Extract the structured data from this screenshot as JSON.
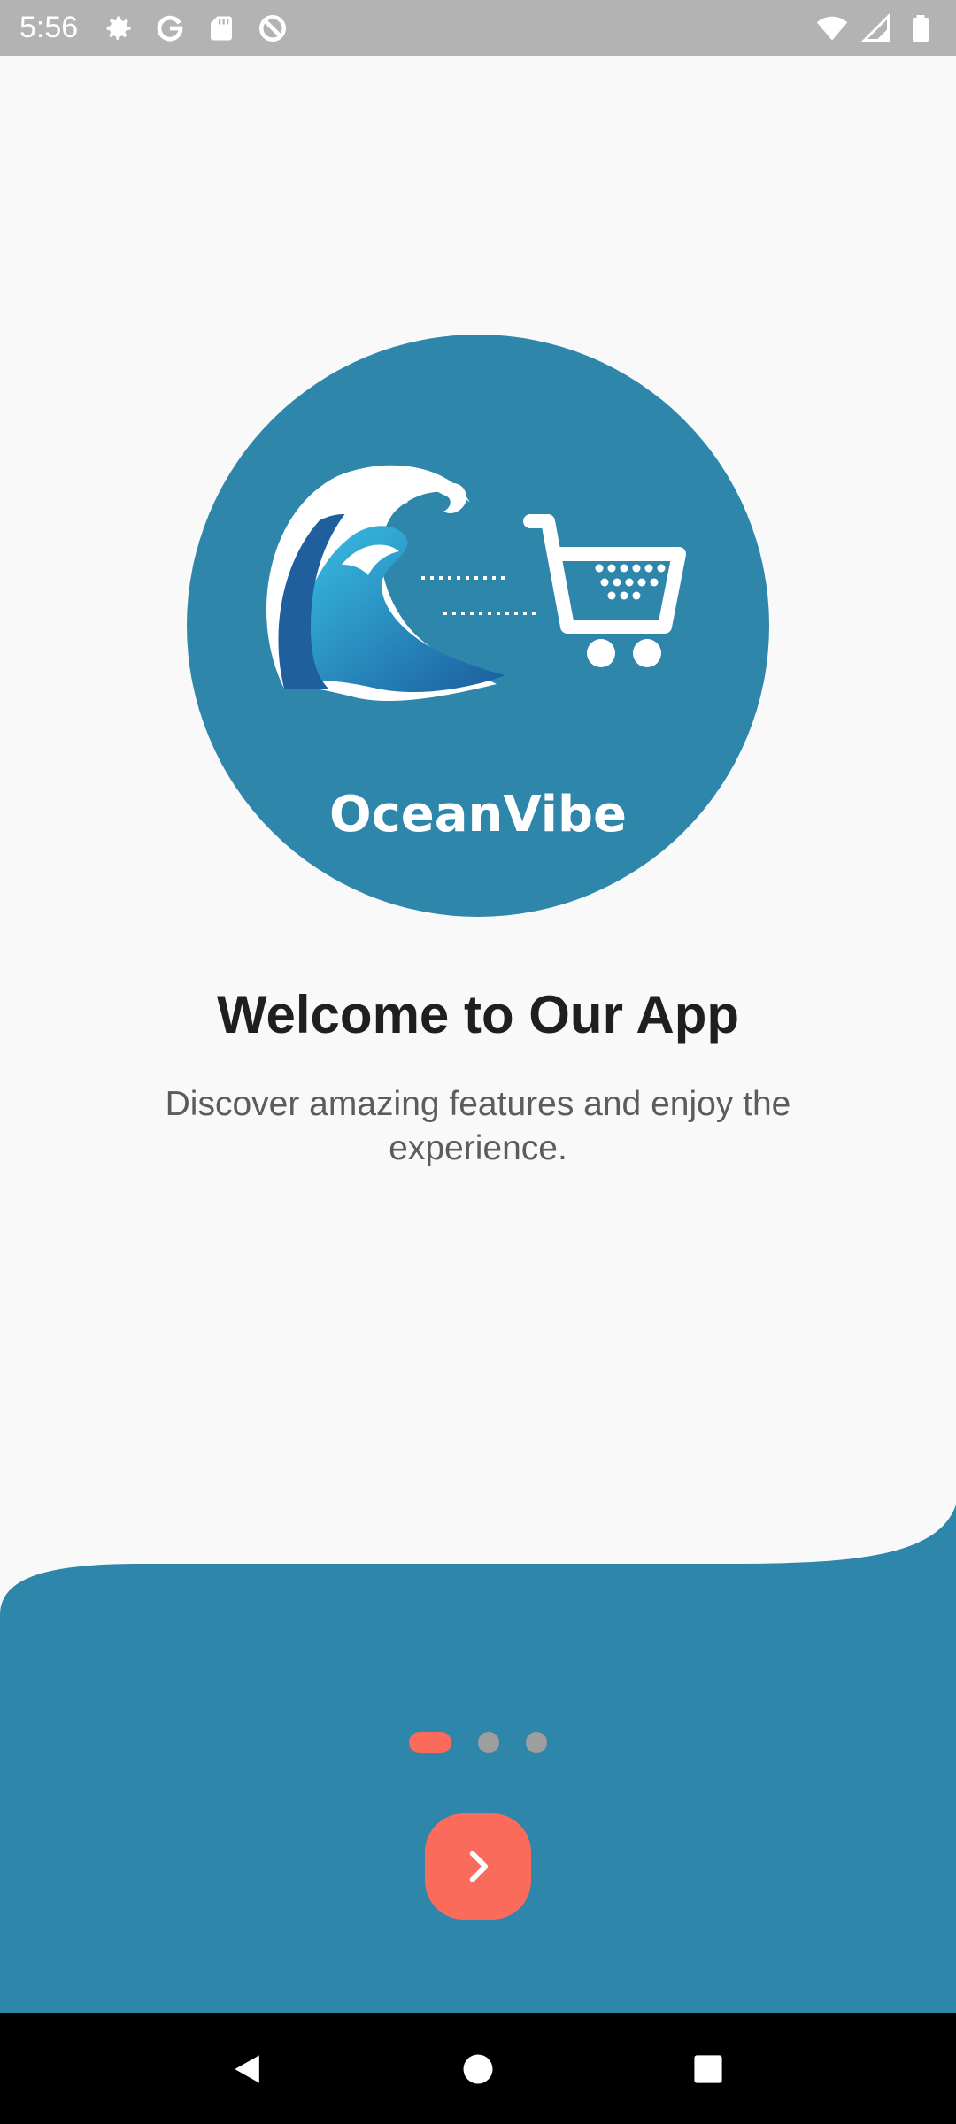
{
  "status_bar": {
    "time": "5:56",
    "left_icons": [
      "settings-icon",
      "google-icon",
      "sd-card-icon",
      "data-saver-icon"
    ],
    "right_icons": [
      "wifi-icon",
      "cell-signal-icon",
      "battery-icon"
    ]
  },
  "logo": {
    "brand_name": "OceanVibe",
    "circle_color": "#2e86ab"
  },
  "onboarding": {
    "title": "Welcome to Our App",
    "subtitle": "Discover amazing features and enjoy the experience.",
    "page_count": 3,
    "current_page": 1
  },
  "colors": {
    "background": "#f9f9f9",
    "wave": "#2e86ab",
    "accent": "#fb6b5b",
    "dot_inactive": "#9e9e9e"
  },
  "next_button": {
    "icon": "chevron-right-icon"
  },
  "nav_bar": {
    "buttons": [
      "back-icon",
      "home-icon",
      "recents-icon"
    ]
  }
}
